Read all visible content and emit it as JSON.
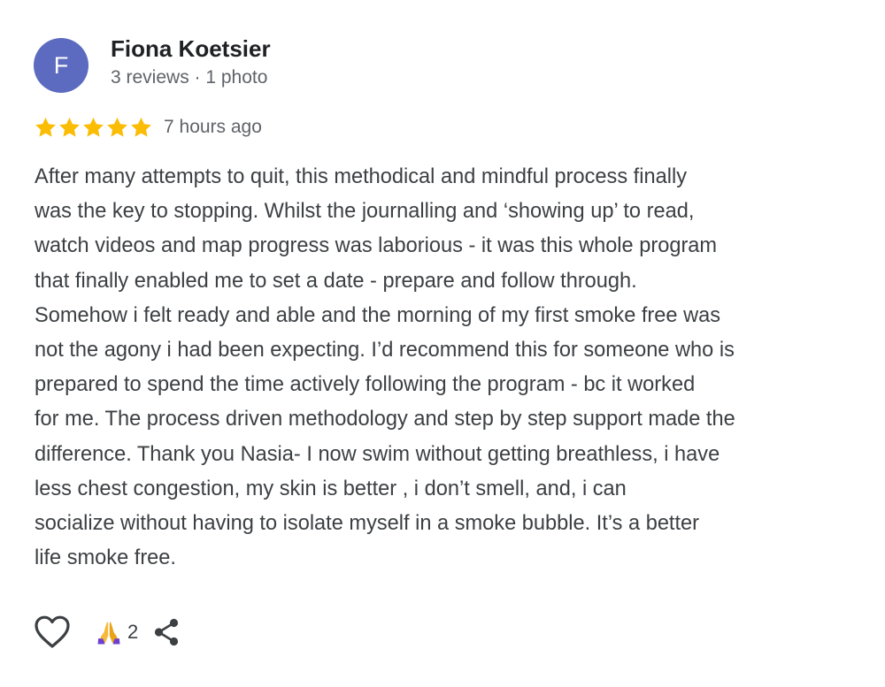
{
  "review": {
    "author": {
      "initial": "F",
      "name": "Fiona Koetsier",
      "meta": "3 reviews · 1 photo",
      "avatar_color": "#5c6bc0"
    },
    "rating": {
      "stars": 5,
      "max_stars": 5,
      "star_color": "#fbbc04",
      "time_ago": "7 hours ago"
    },
    "text_lines": [
      "After many attempts to quit, this methodical and mindful process finally",
      "was the key to stopping. Whilst the journalling and ‘showing up’ to read,",
      "watch videos and map progress was laborious - it was this whole program",
      "that finally enabled me to set a date - prepare and follow through.",
      "Somehow i felt ready and able and the morning of my first smoke free was",
      "not the agony i had been expecting. I’d recommend this for someone who is",
      "prepared to spend the time actively following the program - bc it worked",
      "for me. The process driven methodology and step by step support made the",
      "difference. Thank you Nasia- I now swim without getting breathless, i have",
      "less chest congestion, my skin is better , i don’t smell, and, i can",
      "socialize without having to isolate myself in a smoke bubble. It’s a better",
      "life smoke free."
    ],
    "actions": {
      "like_icon": "heart-outline-icon",
      "reaction_icon": "folded-hands-icon",
      "reaction_count": "2",
      "share_icon": "share-icon"
    }
  }
}
